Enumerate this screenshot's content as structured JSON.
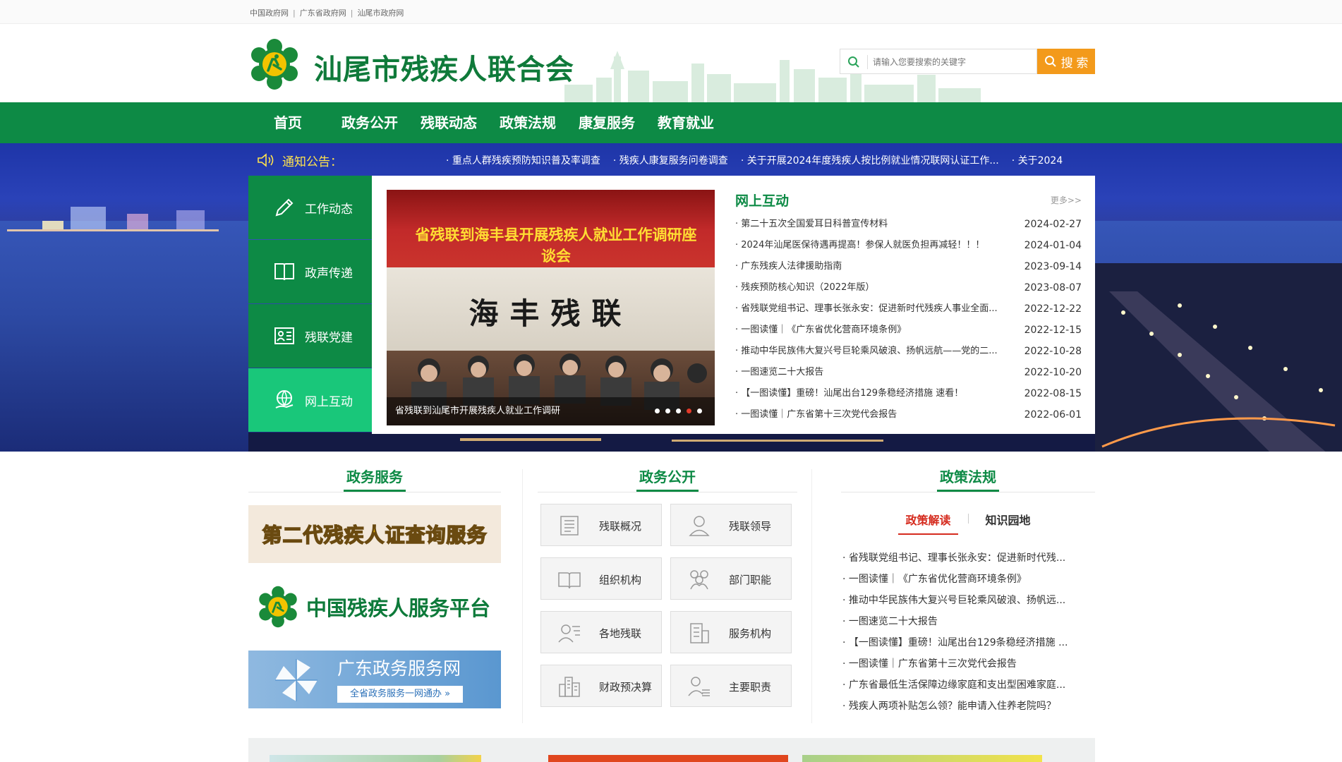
{
  "top_links": [
    "中国政府网",
    "广东省政府网",
    "汕尾市政府网"
  ],
  "site": {
    "title": "汕尾市残疾人联合会"
  },
  "search": {
    "placeholder": "请输入您要搜索的关键字",
    "button": "搜 索"
  },
  "nav": [
    "首页",
    "政务公开",
    "残联动态",
    "政策法规",
    "康复服务",
    "教育就业"
  ],
  "notice": {
    "label": "通知公告：",
    "items": [
      "· 重点人群残疾预防知识普及率调查",
      "· 残疾人康复服务问卷调查",
      "· 关于开展2024年度残疾人按比例就业情况联网认证工作...",
      "· 关于2024"
    ]
  },
  "side_tabs": [
    {
      "label": "工作动态",
      "icon": "pencil-icon"
    },
    {
      "label": "政声传递",
      "icon": "book-icon"
    },
    {
      "label": "残联党建",
      "icon": "id-card-icon"
    },
    {
      "label": "网上互动",
      "icon": "globe-hand-icon",
      "active": true
    }
  ],
  "slide": {
    "banner_text": "省残联到海丰县开展残疾人就业工作调研座谈会",
    "wall_text": "海丰残联",
    "caption": "省残联到汕尾市开展残疾人就业工作调研",
    "dots": 5,
    "active_dot": 4
  },
  "news": {
    "title": "网上互动",
    "more": "更多>>",
    "items": [
      {
        "title": "· 第二十五次全国爱耳日科普宣传材料",
        "date": "2024-02-27"
      },
      {
        "title": "· 2024年汕尾医保待遇再提高！参保人就医负担再减轻！！！",
        "date": "2024-01-04"
      },
      {
        "title": "· 广东残疾人法律援助指南",
        "date": "2023-09-14"
      },
      {
        "title": "· 残疾预防核心知识（2022年版）",
        "date": "2023-08-07"
      },
      {
        "title": "· 省残联党组书记、理事长张永安：促进新时代残疾人事业全面...",
        "date": "2022-12-22"
      },
      {
        "title": "· 一图读懂｜《广东省优化营商环境条例》",
        "date": "2022-12-15"
      },
      {
        "title": "· 推动中华民族伟大复兴号巨轮乘风破浪、扬帆远航——党的二...",
        "date": "2022-10-28"
      },
      {
        "title": "· 一图速览二十大报告",
        "date": "2022-10-20"
      },
      {
        "title": "· 【一图读懂】重磅！汕尾出台129条稳经济措施 速看！",
        "date": "2022-08-15"
      },
      {
        "title": "· 一图读懂｜广东省第十三次党代会报告",
        "date": "2022-06-01"
      }
    ]
  },
  "col1": {
    "title": "政务服务",
    "banner1": "第二代残疾人证查询服务",
    "banner2": "中国残疾人服务平台",
    "banner3": {
      "title": "广东政务服务网",
      "sub": "全省政务服务一网通办 »"
    }
  },
  "col2": {
    "title": "政务公开",
    "buttons": [
      {
        "label": "残联概况",
        "icon": "document-icon"
      },
      {
        "label": "残联领导",
        "icon": "person-icon"
      },
      {
        "label": "组织机构",
        "icon": "open-book-icon"
      },
      {
        "label": "部门职能",
        "icon": "group-icon"
      },
      {
        "label": "各地残联",
        "icon": "contact-card-icon"
      },
      {
        "label": "服务机构",
        "icon": "building-icon"
      },
      {
        "label": "财政预决算",
        "icon": "city-icon"
      },
      {
        "label": "主要职责",
        "icon": "user-list-icon"
      }
    ]
  },
  "col3": {
    "title": "政策法规",
    "tabs": [
      "政策解读",
      "知识园地"
    ],
    "items": [
      "· 省残联党组书记、理事长张永安：促进新时代残...",
      "· 一图读懂｜《广东省优化营商环境条例》",
      "· 推动中华民族伟大复兴号巨轮乘风破浪、扬帆远...",
      "· 一图速览二十大报告",
      "· 【一图读懂】重磅！汕尾出台129条稳经济措施 ...",
      "· 一图读懂｜广东省第十三次党代会报告",
      "· 广东省最低生活保障边缘家庭和支出型困难家庭...",
      "· 残疾人两项补贴怎么领？能申请入住养老院吗？"
    ]
  },
  "colors": {
    "green": "#0d8a45",
    "active_tab": "#19c77a",
    "search_btn": "#f39a1b",
    "accent_red": "#d52b1e"
  }
}
